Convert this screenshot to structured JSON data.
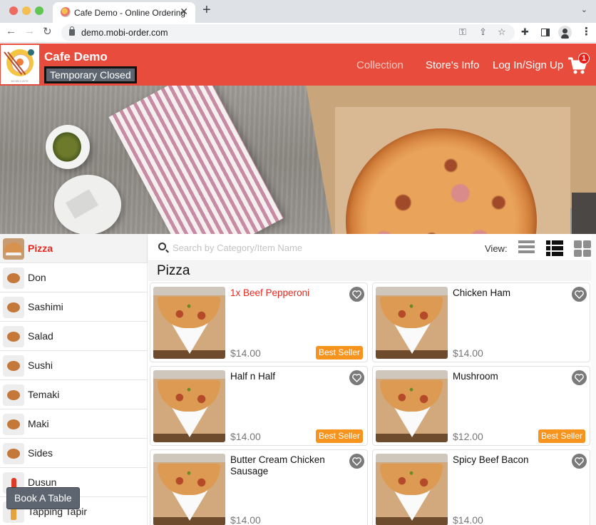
{
  "browser": {
    "tab_title": "Cafe Demo - Online Ordering",
    "url": "demo.mobi-order.com"
  },
  "header": {
    "store_name": "Cafe Demo",
    "status": "Temporary Closed",
    "logo_text": "MOBICAFE",
    "nav": {
      "collection": "Collection",
      "store_info": "Store's Info",
      "login": "Log In/Sign Up"
    },
    "cart_count": "1",
    "brand_color": "#e74c3c"
  },
  "sidebar": {
    "categories": [
      {
        "label": "Pizza",
        "active": true
      },
      {
        "label": "Don"
      },
      {
        "label": "Sashimi"
      },
      {
        "label": "Salad"
      },
      {
        "label": "Sushi"
      },
      {
        "label": "Temaki"
      },
      {
        "label": "Maki"
      },
      {
        "label": "Sides"
      },
      {
        "label": "Dusun"
      },
      {
        "label": "Tapping Tapir"
      }
    ]
  },
  "book_table_label": "Book A Table",
  "search": {
    "placeholder": "Search by Category/Item Name",
    "value": ""
  },
  "view": {
    "label": "View:",
    "options": [
      "list",
      "detail-list",
      "grid"
    ],
    "selected": "detail-list"
  },
  "section": {
    "title": "Pizza",
    "items": [
      {
        "name": "1x Beef Pepperoni",
        "price": "$14.00",
        "badge": "Best Seller",
        "in_cart": true
      },
      {
        "name": "Chicken Ham",
        "price": "$14.00",
        "badge": ""
      },
      {
        "name": "Half n Half",
        "price": "$14.00",
        "badge": "Best Seller"
      },
      {
        "name": "Mushroom",
        "price": "$12.00",
        "badge": "Best Seller"
      },
      {
        "name": "Butter Cream Chicken Sausage",
        "price": "$14.00",
        "badge": ""
      },
      {
        "name": "Spicy Beef Bacon",
        "price": "$14.00",
        "badge": ""
      }
    ]
  },
  "colors": {
    "accent_red": "#e8281e",
    "best_seller": "#f7941d",
    "badge_gray": "#5d6670"
  }
}
